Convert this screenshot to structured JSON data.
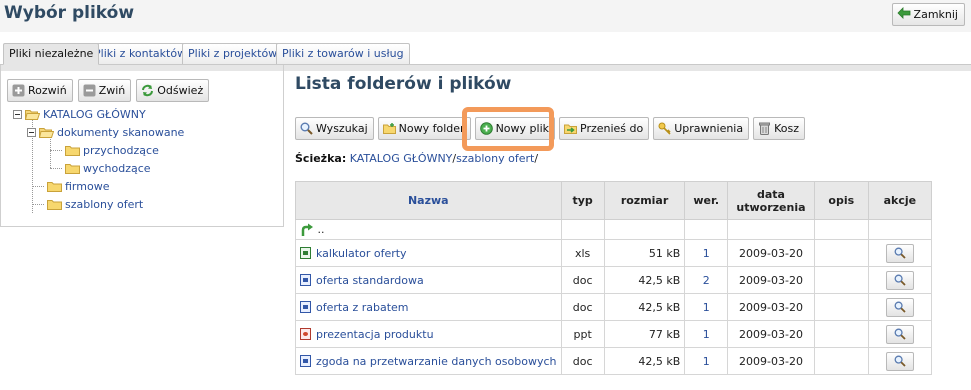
{
  "app": {
    "title": "Wybór plików",
    "close_label": "Zamknij"
  },
  "tabs": [
    {
      "label": "Pliki niezależne",
      "active": true
    },
    {
      "label": "Pliki z kontaktów",
      "active": false
    },
    {
      "label": "Pliki z projektów",
      "active": false
    },
    {
      "label": "Pliki z towarów i usług",
      "active": false
    }
  ],
  "tree": {
    "tools": {
      "expand": "Rozwiń",
      "collapse": "Zwiń",
      "refresh": "Odśwież"
    },
    "root": "KATALOG GŁÓWNY",
    "nodes": {
      "scanned": "dokumenty skanowane",
      "incoming": "przychodzące",
      "outgoing": "wychodzące",
      "company": "firmowe",
      "templates": "szablony ofert"
    }
  },
  "main": {
    "title": "Lista folderów i plików",
    "toolbar": {
      "search": "Wyszukaj",
      "new_folder": "Nowy folder",
      "new_file": "Nowy plik",
      "move": "Przenieś do",
      "permissions": "Uprawnienia",
      "trash": "Kosz"
    },
    "path": {
      "label": "Ścieżka:",
      "root": "KATALOG GŁÓWNY",
      "sep1": "/",
      "folder": "szablony ofert",
      "sep2": "/"
    },
    "table": {
      "headers": {
        "name": "Nazwa",
        "type": "typ",
        "size": "rozmiar",
        "version": "wer.",
        "date": "data utworzenia",
        "desc": "opis",
        "actions": "akcje"
      },
      "up_label": "..",
      "rows": [
        {
          "name": "kalkulator oferty",
          "type": "xls",
          "size": "51 kB",
          "version": "1",
          "date": "2009-03-20",
          "desc": ""
        },
        {
          "name": "oferta standardowa",
          "type": "doc",
          "size": "42,5 kB",
          "version": "2",
          "date": "2009-03-20",
          "desc": ""
        },
        {
          "name": "oferta z rabatem",
          "type": "doc",
          "size": "42,5 kB",
          "version": "1",
          "date": "2009-03-20",
          "desc": ""
        },
        {
          "name": "prezentacja produktu",
          "type": "ppt",
          "size": "77 kB",
          "version": "1",
          "date": "2009-03-20",
          "desc": ""
        },
        {
          "name": "zgoda na przetwarzanie danych osobowych",
          "type": "doc",
          "size": "42,5 kB",
          "version": "1",
          "date": "2009-03-20",
          "desc": ""
        }
      ]
    }
  },
  "colors": {
    "title": "#2f4a63",
    "link": "#2a4f9a",
    "highlight": "#f39a5a"
  }
}
